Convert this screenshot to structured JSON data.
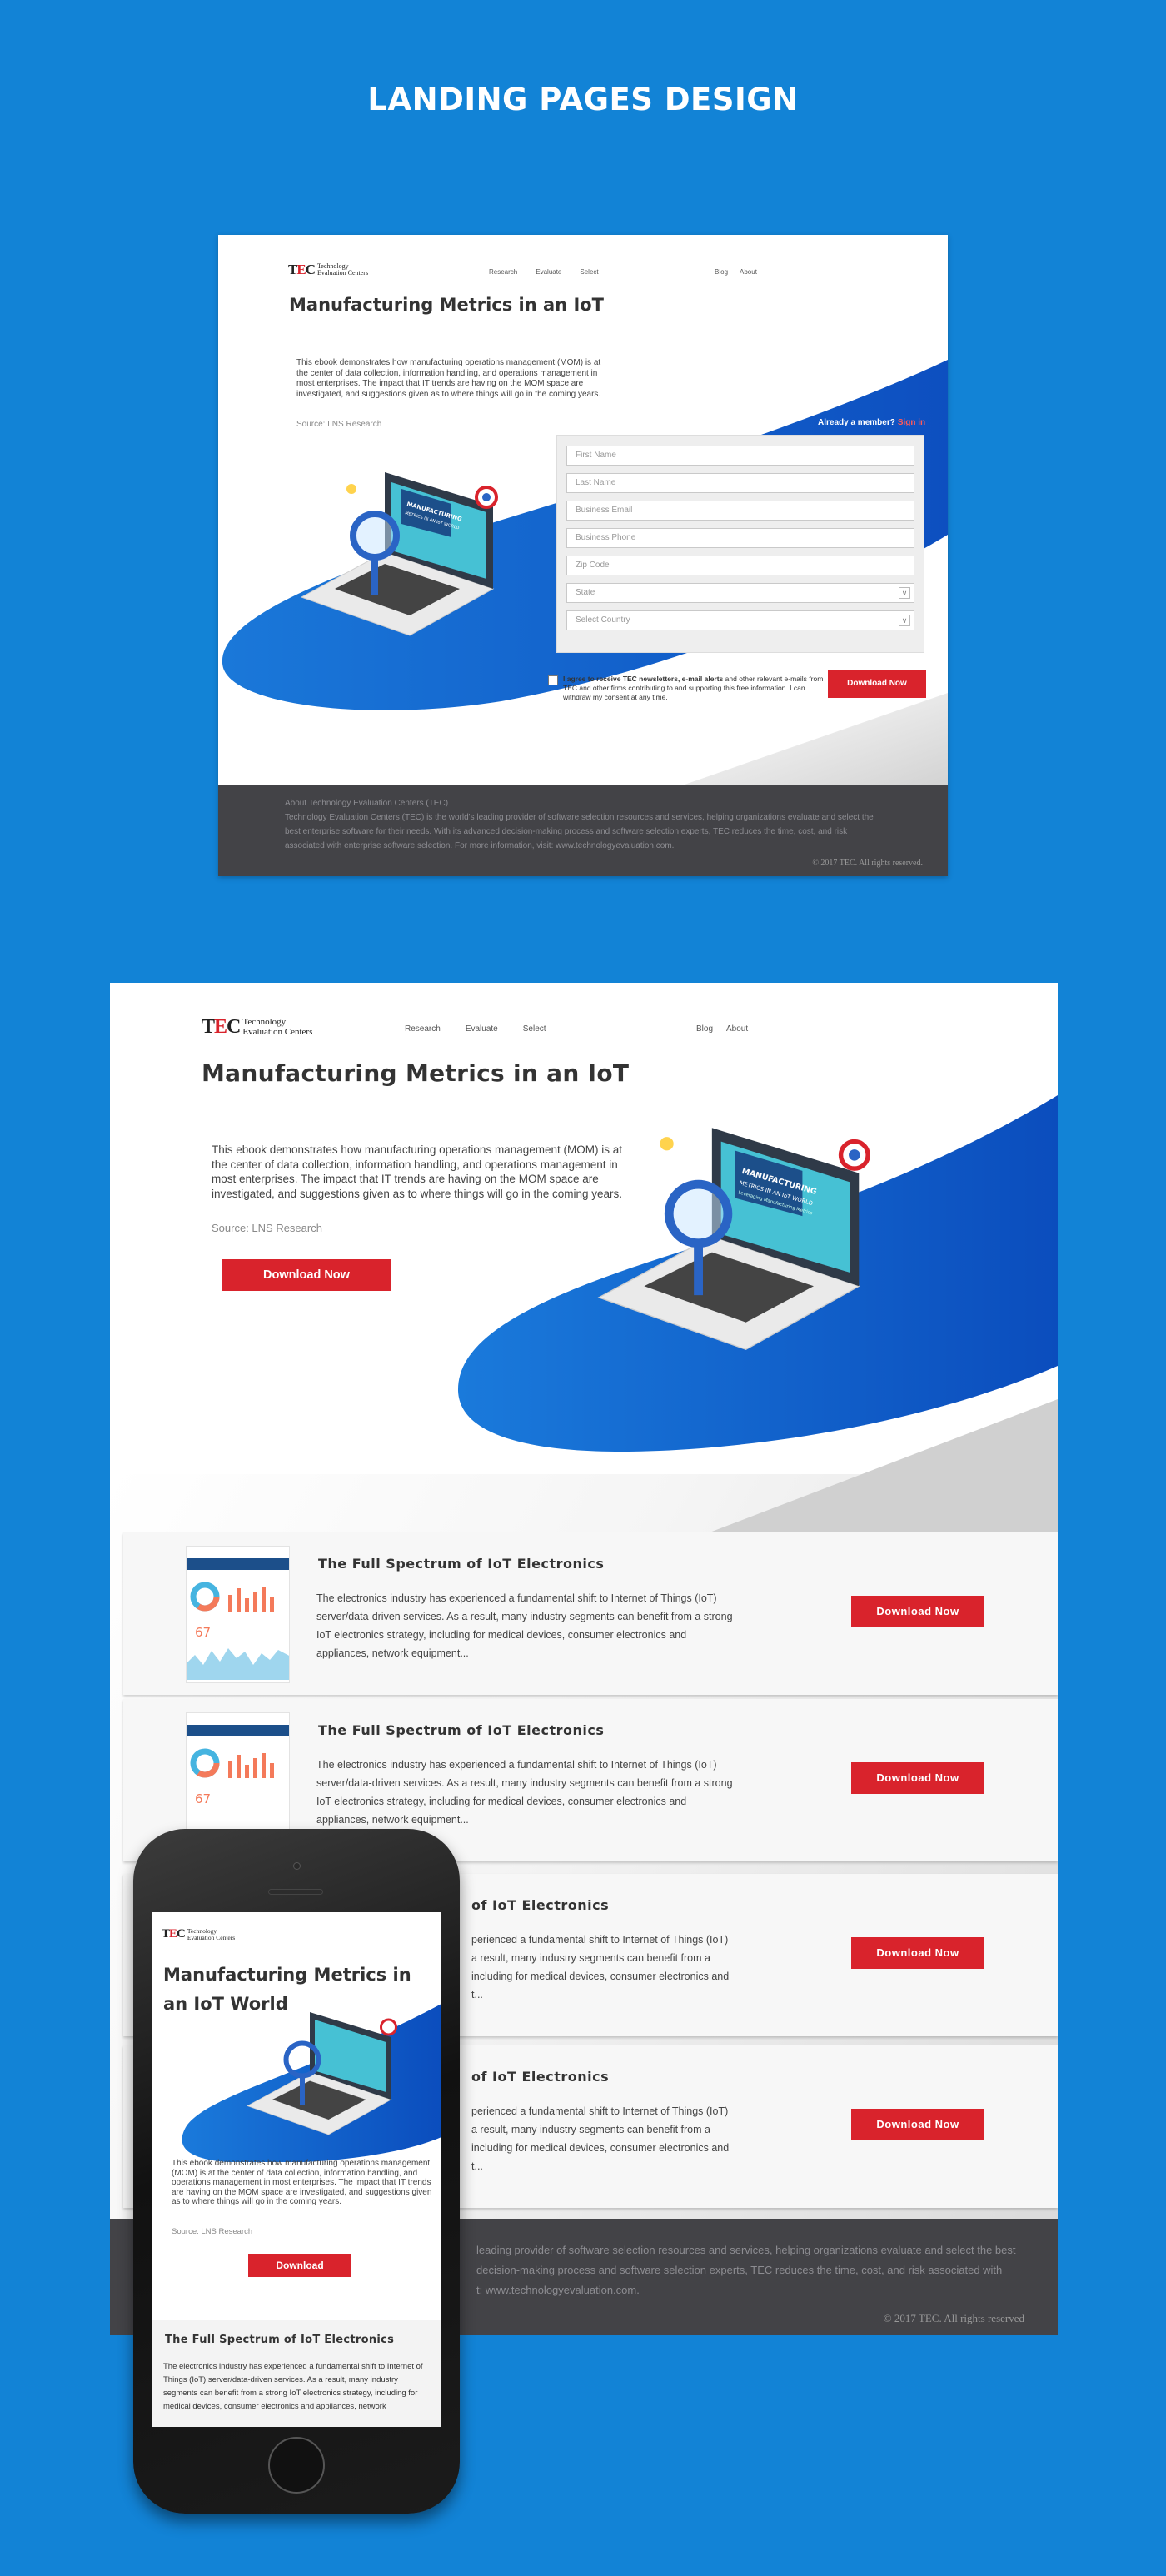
{
  "heading": "LANDING PAGES DESIGN",
  "logo": {
    "mark_t": "T",
    "mark_e": "E",
    "mark_c": "C",
    "line1": "Technology",
    "line2": "Evaluation Centers"
  },
  "nav": {
    "research": "Research",
    "evaluate": "Evaluate",
    "select": "Select",
    "blog": "Blog",
    "about": "About"
  },
  "hero": {
    "title": "Manufacturing Metrics in an IoT",
    "description": "This ebook demonstrates how manufacturing operations management (MOM) is at the center of data collection, information handling, and operations management in most enterprises. The impact that IT trends are having on the MOM space are investigated, and suggestions given as to where things will go in the coming years.",
    "source": "Source: LNS Research",
    "download_label": "Download Now"
  },
  "form": {
    "member_text": "Already a member?",
    "signin_label": "Sign in",
    "fields": [
      "First Name",
      "Last Name",
      "Business Email",
      "Business Phone",
      "Zip Code"
    ],
    "state_placeholder": "State",
    "country_placeholder": "Select Country",
    "consent_bold": "I agree to receive TEC newsletters, e-mail alerts",
    "consent_rest": " and other relevant e-mails from TEC and other firms contributing to and supporting this free information. I can withdraw my consent at any time.",
    "submit_label": "Download Now"
  },
  "footer": {
    "about_title": "About Technology Evaluation Centers (TEC)",
    "about_text": "Technology Evaluation Centers (TEC) is the world's leading provider of software selection resources and services, helping organizations evaluate and select the best enterprise software for their needs. With its advanced decision-making process and software selection experts, TEC reduces the time, cost, and risk associated with enterprise software selection. For more information, visit: www.technologyevaluation.com.",
    "copyright": "© 2017 TEC. All rights reserved."
  },
  "footer2": {
    "line1": "leading provider of software selection resources and services, helping organizations evaluate and select the best",
    "line2": "decision-making process and software selection experts, TEC reduces the time, cost, and risk associated with",
    "line3": "t: www.technologyevaluation.com.",
    "copyright": "© 2017 TEC. All rights reserved"
  },
  "illustration": {
    "title_line1": "MANUFACTURING",
    "title_line2": "METRICS IN AN IoT WORLD",
    "subtitle": "Leveraging Manufacturing Metrics"
  },
  "cards": [
    {
      "title": "The Full Spectrum of IoT Electronics",
      "text": "The electronics industry has experienced a fundamental shift to Internet of Things (IoT) server/data-driven services. As a result, many industry segments can benefit from a strong IoT electronics strategy, including for medical devices, consumer electronics and appliances, network equipment...",
      "button": "Download Now",
      "thumb_value": "67"
    },
    {
      "title": "The Full Spectrum of IoT Electronics",
      "text": "The electronics industry has experienced a fundamental shift to Internet of Things (IoT) server/data-driven services. As a result, many industry segments can benefit from a strong IoT electronics strategy, including for medical devices, consumer electronics and appliances, network equipment...",
      "button": "Download Now",
      "thumb_value": "67"
    },
    {
      "title": "of IoT Electronics",
      "text_lines": [
        "perienced a fundamental shift to Internet of Things (IoT)",
        "a result, many industry segments can benefit from a",
        "including for medical devices, consumer electronics and",
        "t..."
      ],
      "button": "Download Now"
    },
    {
      "title": "of IoT Electronics",
      "text_lines": [
        "perienced a fundamental shift to Internet of Things (IoT)",
        "a result, many industry segments can benefit from a",
        "including for medical devices, consumer electronics and",
        "t..."
      ],
      "button": "Download Now"
    }
  ],
  "mobile": {
    "title": "Manufacturing Metrics in an IoT World",
    "description": "This ebook demonstrates how manufacturing operations management (MOM) is at the center of data collection, information handling, and operations management in most enterprises. The impact that IT trends are having on the MOM space are investigated, and suggestions given as to where things will go in the coming years.",
    "source": "Source: LNS Research",
    "download_label": "Download",
    "card_title": "The Full Spectrum of IoT Electronics",
    "card_text": "The electronics industry has experienced a fundamental shift to Internet of Things (IoT) server/data-driven services. As a result, many industry segments can benefit from a strong IoT electronics strategy, including for medical devices, consumer electronics and appliances, network"
  },
  "colors": {
    "background": "#1283d6",
    "accent_red": "#d9232c",
    "hero_blue": "#1166cc",
    "footer": "#434347"
  }
}
